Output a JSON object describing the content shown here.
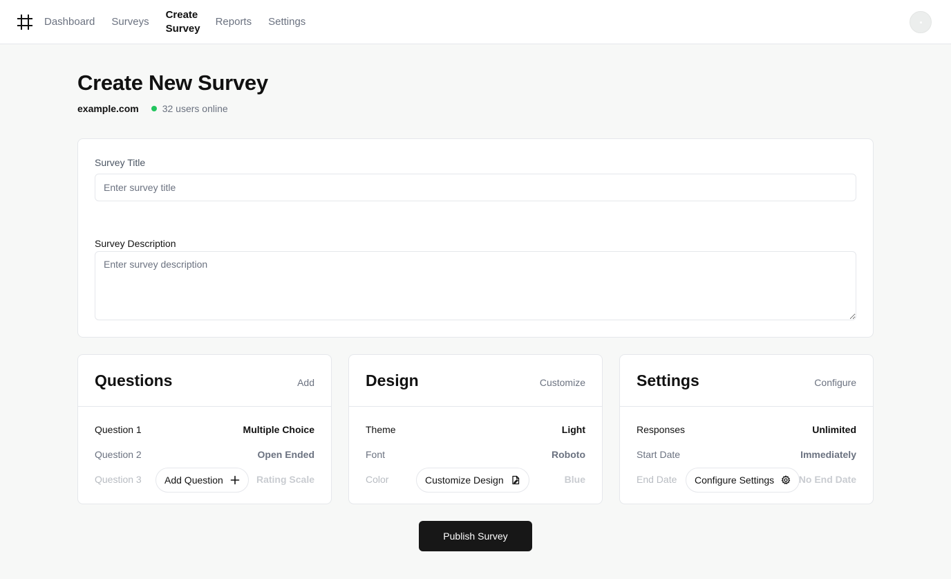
{
  "nav": {
    "logo_icon": "hash-icon",
    "items": [
      {
        "label": "Dashboard",
        "active": false
      },
      {
        "label": "Surveys",
        "active": false
      },
      {
        "label": "Create Survey",
        "active": true
      },
      {
        "label": "Reports",
        "active": false
      },
      {
        "label": "Settings",
        "active": false
      }
    ]
  },
  "header": {
    "title": "Create New Survey",
    "domain": "example.com",
    "online_status": "32 users online",
    "status_color": "#22c55e"
  },
  "form": {
    "title_label": "Survey Title",
    "title_placeholder": "Enter survey title",
    "title_value": "",
    "description_label": "Survey Description",
    "description_placeholder": "Enter survey description",
    "description_value": ""
  },
  "panels": {
    "questions": {
      "title": "Questions",
      "action": "Add",
      "rows": [
        {
          "key": "Question 1",
          "value": "Multiple Choice"
        },
        {
          "key": "Question 2",
          "value": "Open Ended"
        },
        {
          "key": "Question 3",
          "value": "Rating Scale"
        }
      ],
      "button_label": "Add Question",
      "button_icon": "plus-icon"
    },
    "design": {
      "title": "Design",
      "action": "Customize",
      "rows": [
        {
          "key": "Theme",
          "value": "Light"
        },
        {
          "key": "Font",
          "value": "Roboto"
        },
        {
          "key": "Color",
          "value": "Blue"
        }
      ],
      "button_label": "Customize Design",
      "button_icon": "file-edit-icon"
    },
    "settings": {
      "title": "Settings",
      "action": "Configure",
      "rows": [
        {
          "key": "Responses",
          "value": "Unlimited"
        },
        {
          "key": "Start Date",
          "value": "Immediately"
        },
        {
          "key": "End Date",
          "value": "No End Date"
        }
      ],
      "button_label": "Configure Settings",
      "button_icon": "gear-icon"
    }
  },
  "publish_label": "Publish Survey",
  "colors": {
    "background": "#f7f8f7",
    "primary_button": "#171717",
    "border": "#e5e7eb"
  }
}
